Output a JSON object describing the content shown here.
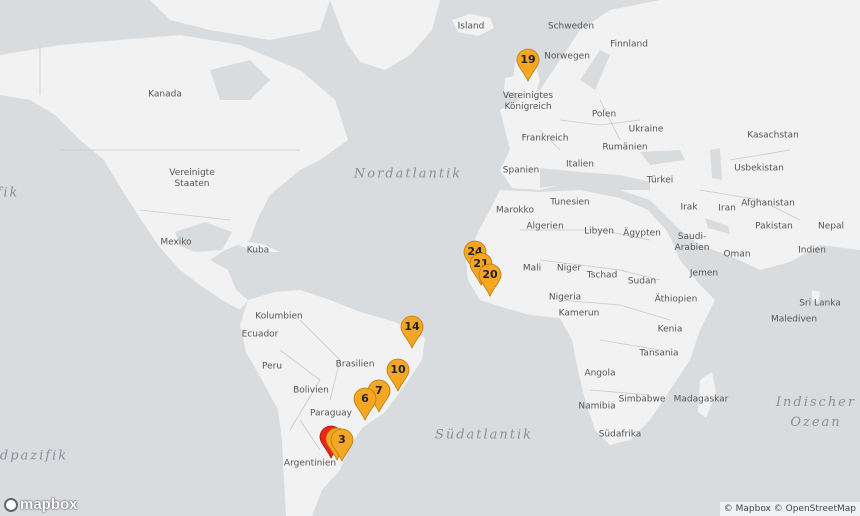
{
  "labels": [
    {
      "name": "label-island",
      "text": "Island"
    },
    {
      "name": "label-schweden",
      "text": "Schweden"
    },
    {
      "name": "label-finnland",
      "text": "Finnland"
    },
    {
      "name": "label-norwegen",
      "text": "Norwegen"
    },
    {
      "name": "label-uk",
      "text": "Vereinigtes Königreich"
    },
    {
      "name": "label-polen",
      "text": "Polen"
    },
    {
      "name": "label-ukraine",
      "text": "Ukraine"
    },
    {
      "name": "label-frankreich",
      "text": "Frankreich"
    },
    {
      "name": "label-rumaenien",
      "text": "Rumänien"
    },
    {
      "name": "label-italien",
      "text": "Italien"
    },
    {
      "name": "label-kasachstan",
      "text": "Kasachstan"
    },
    {
      "name": "label-spanien",
      "text": "Spanien"
    },
    {
      "name": "label-tuerkei",
      "text": "Türkei"
    },
    {
      "name": "label-usbekistan",
      "text": "Usbekistan"
    },
    {
      "name": "label-kanada",
      "text": "Kanada"
    },
    {
      "name": "label-usa",
      "text": "Vereinigte Staaten"
    },
    {
      "name": "label-marokko",
      "text": "Marokko"
    },
    {
      "name": "label-tunesien",
      "text": "Tunesien"
    },
    {
      "name": "label-irak",
      "text": "Irak"
    },
    {
      "name": "label-iran",
      "text": "Iran"
    },
    {
      "name": "label-afghanistan",
      "text": "Afghanistan"
    },
    {
      "name": "label-algerien",
      "text": "Algerien"
    },
    {
      "name": "label-libyen",
      "text": "Libyen"
    },
    {
      "name": "label-aegypten",
      "text": "Ägypten"
    },
    {
      "name": "label-saudi-arabien",
      "text": "Saudi-Arabien"
    },
    {
      "name": "label-pakistan",
      "text": "Pakistan"
    },
    {
      "name": "label-nepal",
      "text": "Nepal"
    },
    {
      "name": "label-mexiko",
      "text": "Mexiko"
    },
    {
      "name": "label-kuba",
      "text": "Kuba"
    },
    {
      "name": "label-indien",
      "text": "Indien"
    },
    {
      "name": "label-oman",
      "text": "Oman"
    },
    {
      "name": "label-mali",
      "text": "Mali"
    },
    {
      "name": "label-niger",
      "text": "Niger"
    },
    {
      "name": "label-tschad",
      "text": "Tschad"
    },
    {
      "name": "label-sudan",
      "text": "Sudan"
    },
    {
      "name": "label-jemen",
      "text": "Jemen"
    },
    {
      "name": "label-nigeria",
      "text": "Nigeria"
    },
    {
      "name": "label-aethiopien",
      "text": "Äthiopien"
    },
    {
      "name": "label-sri-lanka",
      "text": "Sri Lanka"
    },
    {
      "name": "label-kolumbien",
      "text": "Kolumbien"
    },
    {
      "name": "label-kamerun",
      "text": "Kamerun"
    },
    {
      "name": "label-malediven",
      "text": "Malediven"
    },
    {
      "name": "label-ecuador",
      "text": "Ecuador"
    },
    {
      "name": "label-kenia",
      "text": "Kenia"
    },
    {
      "name": "label-brasilien",
      "text": "Brasilien"
    },
    {
      "name": "label-peru",
      "text": "Peru"
    },
    {
      "name": "label-tansania",
      "text": "Tansania"
    },
    {
      "name": "label-angola",
      "text": "Angola"
    },
    {
      "name": "label-bolivien",
      "text": "Bolivien"
    },
    {
      "name": "label-simbabwe",
      "text": "Simbabwe"
    },
    {
      "name": "label-madagaskar",
      "text": "Madagaskar"
    },
    {
      "name": "label-namibia",
      "text": "Namibia"
    },
    {
      "name": "label-paraguay",
      "text": "Paraguay"
    },
    {
      "name": "label-suedafrika",
      "text": "Südafrika"
    },
    {
      "name": "label-argentinien",
      "text": "Argentinien"
    }
  ],
  "oceans": [
    {
      "name": "ocean-nordatlantik",
      "text": "Nordatlantik"
    },
    {
      "name": "ocean-suedatlantik",
      "text": "Südatlantik"
    },
    {
      "name": "ocean-indischer-ozean",
      "text": "Indischer Ozean"
    },
    {
      "name": "ocean-suedpazifik-partial",
      "text": "dpazifik"
    },
    {
      "name": "ocean-pazifik-partial",
      "text": "fik"
    }
  ],
  "markers": [
    {
      "label": "19",
      "color": "#f5a623"
    },
    {
      "label": "24",
      "color": "#f5a623"
    },
    {
      "label": "21",
      "color": "#f5a623"
    },
    {
      "label": "20",
      "color": "#f5a623"
    },
    {
      "label": "14",
      "color": "#f5a623"
    },
    {
      "label": "10",
      "color": "#f5a623"
    },
    {
      "label": "7",
      "color": "#f5a623"
    },
    {
      "label": "6",
      "color": "#f5a623"
    },
    {
      "label": "",
      "color": "#e8261c"
    },
    {
      "label": "",
      "color": "#f5a623"
    },
    {
      "label": "3",
      "color": "#f5a623"
    }
  ],
  "logo": {
    "text": "mapbox",
    "icon": "mapbox-logo-icon"
  },
  "attribution": {
    "mapbox": "© Mapbox",
    "osm": "© OpenStreetMap"
  },
  "colors": {
    "water": "#d9dcde",
    "land": "#f2f2f2",
    "border": "#c9c9c9",
    "marker": "#f5a623",
    "marker_red": "#e8261c"
  }
}
